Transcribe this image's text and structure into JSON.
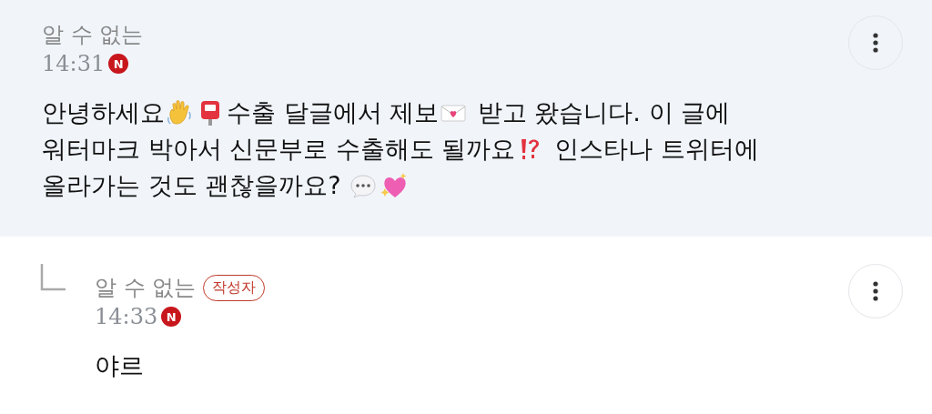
{
  "comments": [
    {
      "author": "알 수 없는",
      "time": "14:31",
      "new_mark": "N",
      "reply": false,
      "lines": [
        [
          {
            "kind": "text",
            "text": "안녕하세요"
          },
          {
            "kind": "emoji"
          },
          {
            "kind": "emoji"
          },
          {
            "kind": "text",
            "text": "수출 달글에서 제보"
          },
          {
            "kind": "emoji"
          },
          {
            "kind": "text",
            "text": " 받고 왔습니다. 이 글에"
          }
        ],
        [
          {
            "kind": "text",
            "text": "워터마크 박아서 신문부로 수출해도 될까요"
          },
          {
            "kind": "emoji"
          },
          {
            "kind": "text",
            "text": " 인스타나 트위터에"
          }
        ],
        [
          {
            "kind": "text",
            "text": "올라가는 것도 괜찮을까요? "
          },
          {
            "kind": "emoji"
          },
          {
            "kind": "emoji"
          }
        ]
      ]
    },
    {
      "author": "알 수 없는",
      "badge": "작성자",
      "time": "14:33",
      "new_mark": "N",
      "reply": true,
      "lines": [
        [
          {
            "kind": "text",
            "text": "야르"
          }
        ]
      ]
    }
  ]
}
